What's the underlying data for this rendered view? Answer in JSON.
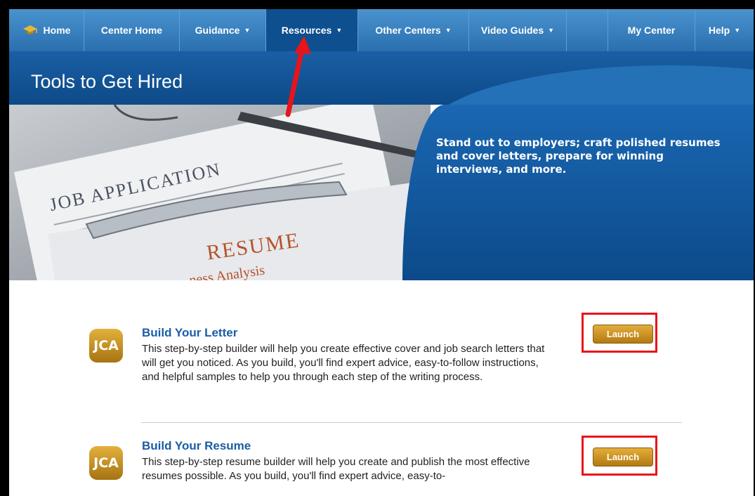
{
  "nav": {
    "home": "Home",
    "center_home": "Center Home",
    "guidance": "Guidance",
    "resources": "Resources",
    "other_centers": "Other Centers",
    "video_guides": "Video Guides",
    "my_center": "My Center",
    "help": "Help",
    "caret": "▼"
  },
  "hero": {
    "title": "Tools to Get Hired",
    "tagline": "Stand out to employers; craft polished resumes and cover letters, prepare for winning interviews, and more.",
    "image_text": {
      "job_application": "JOB APPLICATION",
      "resume": "RESUME",
      "analysis": "ness Analysis"
    }
  },
  "tools": [
    {
      "badge": "JCA",
      "title": "Build Your Letter",
      "description": "This step-by-step builder will help you create effective cover and job search letters that will get you noticed. As you build, you'll find expert advice, easy-to-follow instructions, and helpful samples to help you through each step of the writing process.",
      "button": "Launch"
    },
    {
      "badge": "JCA",
      "title": "Build Your Resume",
      "description": "This step-by-step resume builder will help you create and publish the most effective resumes possible. As you build, you'll find expert advice, easy-to-",
      "button": "Launch"
    }
  ],
  "colors": {
    "nav": "#2a6fae",
    "nav_active": "#0e4f8f",
    "title_blue": "#1b5da6",
    "highlight_red": "#e8141a",
    "button_gold": "#c68f24"
  },
  "icons": {
    "home": "mortarboard-icon",
    "caret": "caret-down-icon"
  }
}
